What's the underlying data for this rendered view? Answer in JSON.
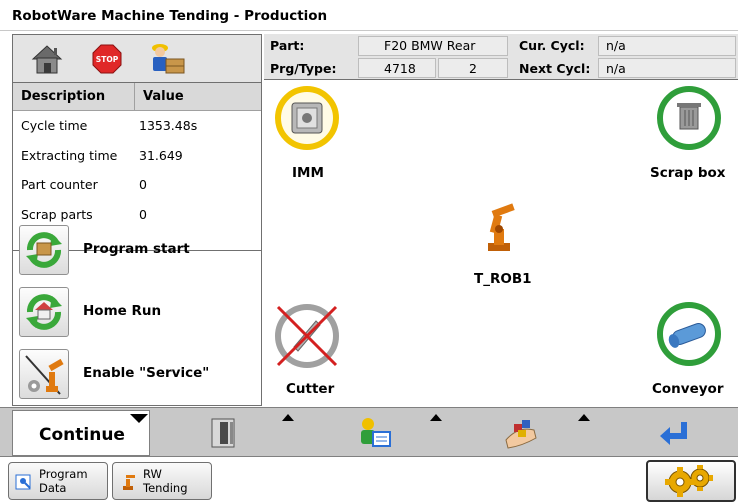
{
  "window": {
    "title": "RobotWare Machine Tending - Production"
  },
  "info": {
    "part_label": "Part:",
    "part_value": "F20 BMW Rear",
    "prg_label": "Prg/Type:",
    "prg_value": "4718",
    "type_value": "2",
    "cur_cycle_label": "Cur. Cycl:",
    "cur_cycle_value": "n/a",
    "next_cycle_label": "Next Cycl:",
    "next_cycle_value": "n/a"
  },
  "iconbar": {
    "icons": [
      "home-icon",
      "stop-sign-icon",
      "worker-box-icon"
    ]
  },
  "table": {
    "headers": {
      "description": "Description",
      "value": "Value"
    },
    "rows": [
      {
        "description": "Cycle time",
        "value": "1353.48s"
      },
      {
        "description": "Extracting time",
        "value": "31.649"
      },
      {
        "description": "Part counter",
        "value": "0"
      },
      {
        "description": "Scrap parts",
        "value": "0"
      }
    ]
  },
  "actions": {
    "program_start": "Program start",
    "home_run": "Home Run",
    "enable_service": "Enable \"Service\""
  },
  "stations": {
    "imm": "IMM",
    "scrap_box": "Scrap box",
    "robot": "T_ROB1",
    "cutter": "Cutter",
    "conveyor": "Conveyor"
  },
  "toolbar": {
    "continue_label": "Continue",
    "icons": [
      "machine-door-icon",
      "operator-screen-icon",
      "parts-handling-icon",
      "enter-return-icon"
    ]
  },
  "taskbar": {
    "program_data": [
      "Program",
      "Data"
    ],
    "rw_tending": [
      "RW",
      "Tending"
    ]
  },
  "colors": {
    "ring_yellow": "#f2c400",
    "ring_green": "#2f9e3a",
    "ring_gray": "#a0a0a0",
    "cross_red": "#d42020",
    "robot_orange": "#e07a10",
    "accent_blue": "#2a6fd6"
  }
}
